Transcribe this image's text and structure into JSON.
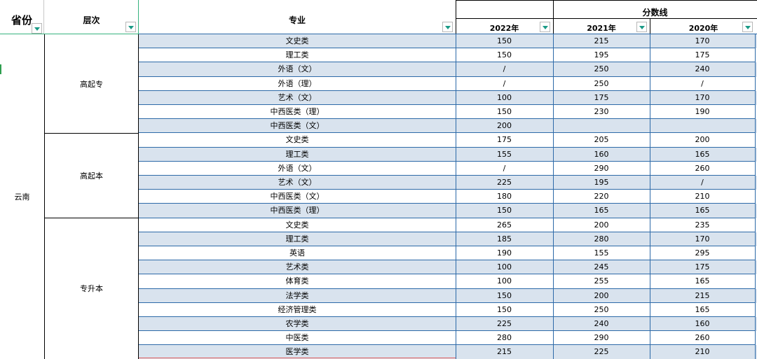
{
  "header": {
    "province": "省份",
    "level": "层次",
    "major": "专业",
    "score_group": "分数线",
    "year_2022": "2022年",
    "year_2021": "2021年",
    "year_2020": "2020年"
  },
  "province_value": "云南",
  "groups": [
    {
      "level": "高起专",
      "rows": [
        {
          "major": "文史类",
          "y2022": "150",
          "y2021": "215",
          "y2020": "170"
        },
        {
          "major": "理工类",
          "y2022": "150",
          "y2021": "195",
          "y2020": "175"
        },
        {
          "major": "外语（文）",
          "y2022": "/",
          "y2021": "250",
          "y2020": "240"
        },
        {
          "major": "外语（理）",
          "y2022": "/",
          "y2021": "250",
          "y2020": "/"
        },
        {
          "major": "艺术（文）",
          "y2022": "100",
          "y2021": "175",
          "y2020": "170"
        },
        {
          "major": "中西医类（理）",
          "y2022": "150",
          "y2021": "230",
          "y2020": "190"
        },
        {
          "major": "中西医类（文）",
          "y2022": "200",
          "y2021": "",
          "y2020": ""
        }
      ]
    },
    {
      "level": "高起本",
      "rows": [
        {
          "major": "文史类",
          "y2022": "175",
          "y2021": "205",
          "y2020": "200"
        },
        {
          "major": "理工类",
          "y2022": "155",
          "y2021": "160",
          "y2020": "165"
        },
        {
          "major": "外语（文）",
          "y2022": "/",
          "y2021": "290",
          "y2020": "260"
        },
        {
          "major": "艺术（文）",
          "y2022": "225",
          "y2021": "195",
          "y2020": "/"
        },
        {
          "major": "中西医类（文）",
          "y2022": "180",
          "y2021": "220",
          "y2020": "210"
        },
        {
          "major": "中西医类（理）",
          "y2022": "150",
          "y2021": "165",
          "y2020": "165"
        }
      ]
    },
    {
      "level": "专升本",
      "rows": [
        {
          "major": "文史类",
          "y2022": "265",
          "y2021": "200",
          "y2020": "235"
        },
        {
          "major": "理工类",
          "y2022": "185",
          "y2021": "280",
          "y2020": "170"
        },
        {
          "major": "英语",
          "y2022": "190",
          "y2021": "155",
          "y2020": "295"
        },
        {
          "major": "艺术类",
          "y2022": "100",
          "y2021": "245",
          "y2020": "175"
        },
        {
          "major": "体育类",
          "y2022": "100",
          "y2021": "255",
          "y2020": "165"
        },
        {
          "major": "法学类",
          "y2022": "150",
          "y2021": "200",
          "y2020": "215"
        },
        {
          "major": "经济管理类",
          "y2022": "150",
          "y2021": "250",
          "y2020": "165"
        },
        {
          "major": "农学类",
          "y2022": "225",
          "y2021": "240",
          "y2020": "160"
        },
        {
          "major": "中医类",
          "y2022": "280",
          "y2021": "290",
          "y2020": "260"
        },
        {
          "major": "医学类",
          "y2022": "215",
          "y2021": "225",
          "y2020": "210"
        }
      ]
    }
  ],
  "colors": {
    "shaded_row": "#d9e3ee",
    "grid_blue": "#2d6aa8",
    "header_accent": "#1a9a86"
  }
}
